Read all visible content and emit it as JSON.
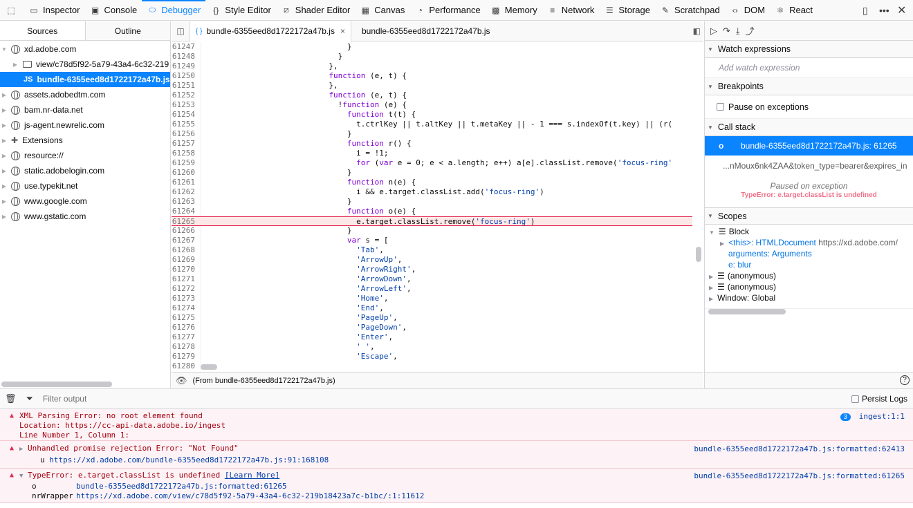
{
  "toolbar": {
    "tabs": [
      {
        "label": "Inspector",
        "icon": "inspector-icon",
        "glyph": "▭"
      },
      {
        "label": "Console",
        "icon": "console-icon",
        "glyph": "▣"
      },
      {
        "label": "Debugger",
        "icon": "debugger-icon",
        "glyph": "⬭",
        "active": true
      },
      {
        "label": "Style Editor",
        "icon": "style-editor-icon",
        "glyph": "{}"
      },
      {
        "label": "Shader Editor",
        "icon": "shader-editor-icon",
        "glyph": "⧄"
      },
      {
        "label": "Canvas",
        "icon": "canvas-icon",
        "glyph": "▦"
      },
      {
        "label": "Performance",
        "icon": "performance-icon",
        "glyph": "◔"
      },
      {
        "label": "Memory",
        "icon": "memory-icon",
        "glyph": "▩"
      },
      {
        "label": "Network",
        "icon": "network-icon",
        "glyph": "≡"
      },
      {
        "label": "Storage",
        "icon": "storage-icon",
        "glyph": "☰"
      },
      {
        "label": "Scratchpad",
        "icon": "scratchpad-icon",
        "glyph": "✎"
      },
      {
        "label": "DOM",
        "icon": "dom-icon",
        "glyph": "‹›"
      },
      {
        "label": "React",
        "icon": "react-icon",
        "glyph": "⚛"
      }
    ]
  },
  "sources": {
    "tabs": [
      "Sources",
      "Outline"
    ],
    "items": [
      {
        "label": "xd.adobe.com",
        "indent": 0,
        "type": "globe",
        "open": true
      },
      {
        "label": "view/c78d5f92-5a79-43a4-6c32-219",
        "indent": 1,
        "type": "folder"
      },
      {
        "label": "bundle-6355eed8d1722172a47b.js",
        "indent": 2,
        "type": "js",
        "selected": true
      },
      {
        "label": "assets.adobedtm.com",
        "indent": 0,
        "type": "globe"
      },
      {
        "label": "bam.nr-data.net",
        "indent": 0,
        "type": "globe"
      },
      {
        "label": "js-agent.newrelic.com",
        "indent": 0,
        "type": "globe"
      },
      {
        "label": "Extensions",
        "indent": 0,
        "type": "ext"
      },
      {
        "label": "resource://",
        "indent": 0,
        "type": "globe"
      },
      {
        "label": "static.adobelogin.com",
        "indent": 0,
        "type": "globe"
      },
      {
        "label": "use.typekit.net",
        "indent": 0,
        "type": "globe"
      },
      {
        "label": "www.google.com",
        "indent": 0,
        "type": "globe"
      },
      {
        "label": "www.gstatic.com",
        "indent": 0,
        "type": "globe"
      }
    ]
  },
  "editor": {
    "tabs": [
      {
        "label": "bundle-6355eed8d1722172a47b.js",
        "close": "×"
      },
      {
        "label": "bundle-6355eed8d1722172a47b.js"
      }
    ],
    "footer": "(From bundle-6355eed8d1722172a47b.js)",
    "lines": [
      {
        "n": "61247",
        "t": "                                }"
      },
      {
        "n": "61248",
        "t": "                              }"
      },
      {
        "n": "61249",
        "t": "                            },"
      },
      {
        "n": "61250",
        "t": "                            function (e, t) {"
      },
      {
        "n": "61251",
        "t": "                            },"
      },
      {
        "n": "61252",
        "t": "                            function (e, t) {"
      },
      {
        "n": "61253",
        "t": "                              !function (e) {"
      },
      {
        "n": "61254",
        "t": "                                function t(t) {"
      },
      {
        "n": "61255",
        "t": "                                  t.ctrlKey || t.altKey || t.metaKey || - 1 === s.indexOf(t.key) || (r("
      },
      {
        "n": "61256",
        "t": "                                }"
      },
      {
        "n": "61257",
        "t": "                                function r() {"
      },
      {
        "n": "61258",
        "t": "                                  i = !1;"
      },
      {
        "n": "61259",
        "t": "                                  for (var e = 0; e < a.length; e++) a[e].classList.remove('focus-ring'"
      },
      {
        "n": "61260",
        "t": "                                }"
      },
      {
        "n": "61261",
        "t": "                                function n(e) {"
      },
      {
        "n": "61262",
        "t": "                                  i && e.target.classList.add('focus-ring')"
      },
      {
        "n": "61263",
        "t": "                                }"
      },
      {
        "n": "61264",
        "t": "                                function o(e) {"
      },
      {
        "n": "61265",
        "t": "                                  e.target.classList.remove('focus-ring')",
        "hl": true
      },
      {
        "n": "61266",
        "t": "                                }"
      },
      {
        "n": "61267",
        "t": "                                var s = ["
      },
      {
        "n": "61268",
        "t": "                                  'Tab',"
      },
      {
        "n": "61269",
        "t": "                                  'ArrowUp',"
      },
      {
        "n": "61270",
        "t": "                                  'ArrowRight',"
      },
      {
        "n": "61271",
        "t": "                                  'ArrowDown',"
      },
      {
        "n": "61272",
        "t": "                                  'ArrowLeft',"
      },
      {
        "n": "61273",
        "t": "                                  'Home',"
      },
      {
        "n": "61274",
        "t": "                                  'End',"
      },
      {
        "n": "61275",
        "t": "                                  'PageUp',"
      },
      {
        "n": "61276",
        "t": "                                  'PageDown',"
      },
      {
        "n": "61277",
        "t": "                                  'Enter',"
      },
      {
        "n": "61278",
        "t": "                                  ' ',"
      },
      {
        "n": "61279",
        "t": "                                  'Escape',"
      },
      {
        "n": "61280",
        "t": ""
      }
    ]
  },
  "right": {
    "watch": {
      "title": "Watch expressions",
      "placeholder": "Add watch expression"
    },
    "breakpoints": {
      "title": "Breakpoints",
      "pause_label": "Pause on exceptions"
    },
    "callstack": {
      "title": "Call stack",
      "selected_fn": "o",
      "selected_loc": "bundle-6355eed8d1722172a47b.js: 61265",
      "second": "...nMoux6nk4ZAA&token_type=bearer&expires_in",
      "paused": "Paused on exception",
      "error": "TypeError: e.target.classList is undefined"
    },
    "scopes": {
      "title": "Scopes",
      "block": "Block",
      "this_label": "<this>: HTMLDocument",
      "this_url": "https://xd.adobe.com/",
      "arguments": "arguments: Arguments",
      "e": "e: blur",
      "anon1": "(anonymous)",
      "anon2": "(anonymous)",
      "window": "Window: Global"
    }
  },
  "console": {
    "filter_placeholder": "Filter output",
    "persist": "Persist Logs",
    "msg1": {
      "lines": [
        "XML Parsing Error: no root element found",
        "Location: https://cc-api-data.adobe.io/ingest",
        "Line Number 1, Column 1:"
      ],
      "count": "3",
      "src": "ingest:1:1"
    },
    "msg2": {
      "title": "Unhandled promise rejection Error: \"Not Found\"",
      "src": "bundle-6355eed8d1722172a47b.js:formatted:62413",
      "sub_fn": "u",
      "sub_url": "https://xd.adobe.com/bundle-6355eed8d1722172a47b.js:91:168108"
    },
    "msg3": {
      "title": "TypeError: e.target.classList is undefined",
      "learn": "[Learn More]",
      "src": "bundle-6355eed8d1722172a47b.js:formatted:61265",
      "frames": [
        {
          "fn": "o",
          "loc": "bundle-6355eed8d1722172a47b.js:formatted:61265"
        },
        {
          "fn": "nrWrapper",
          "loc": "https://xd.adobe.com/view/c78d5f92-5a79-43a4-6c32-219b18423a7c-b1bc/:1:11612"
        }
      ]
    }
  }
}
